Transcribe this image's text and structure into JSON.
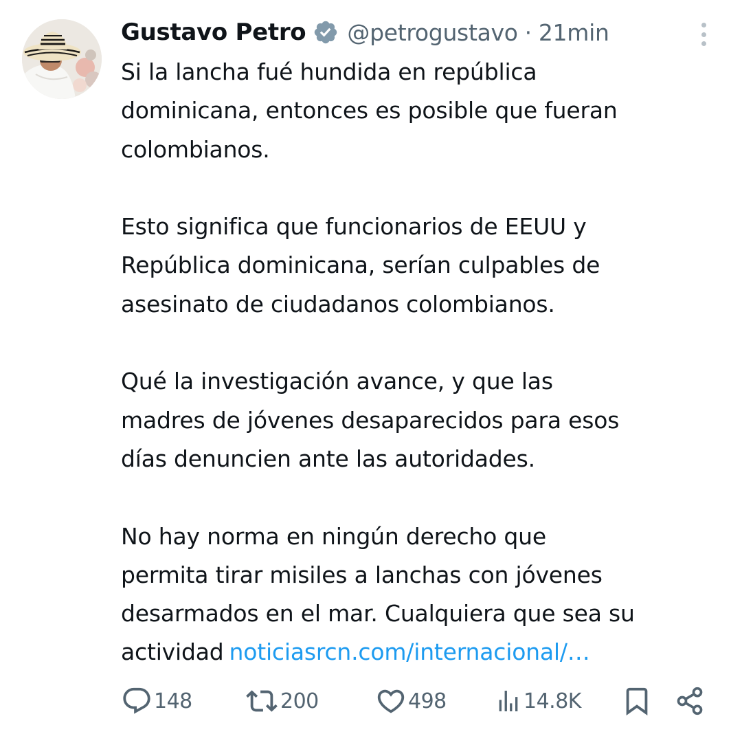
{
  "tweet": {
    "display_name": "Gustavo Petro",
    "handle": "@petrogustavo",
    "separator": "·",
    "time": "21min",
    "paragraphs": [
      [
        "Si la lancha fué hundida en república",
        "dominicana, entonces es posible que fueran",
        "colombianos."
      ],
      [
        "Esto significa que funcionarios de EEUU y",
        "República dominicana, serían culpables de",
        "asesinato de ciudadanos colombianos."
      ],
      [
        "Qué la investigación avance, y que las",
        "madres de jóvenes desaparecidos para esos",
        "días denuncien ante las autoridades."
      ],
      [
        "No hay norma en ningún derecho que",
        "permita tirar misiles a lanchas con jóvenes",
        "desarmados en el mar. Cualquiera que sea su",
        "actividad"
      ]
    ],
    "link_text": "noticiasrcn.com/internacional/…"
  },
  "actions": {
    "replies": "148",
    "reposts": "200",
    "likes": "498",
    "views": "14.8K"
  },
  "icons": [
    "verified-badge-icon",
    "more-options-icon",
    "reply-icon",
    "repost-icon",
    "like-icon",
    "views-icon",
    "bookmark-icon",
    "share-icon"
  ],
  "colors": {
    "text": "#0f1419",
    "secondary": "#536471",
    "link": "#1d9bf0",
    "verified": "#829aab",
    "more_dots": "#b8c1c8"
  }
}
